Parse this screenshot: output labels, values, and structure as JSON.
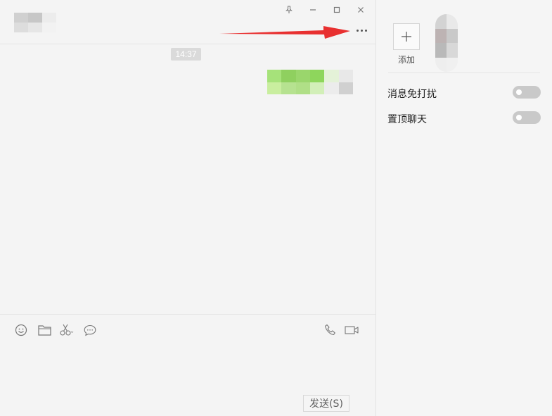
{
  "window": {
    "controls": [
      {
        "name": "pin",
        "icon": "pin-icon"
      },
      {
        "name": "minimize",
        "icon": "minimize-icon"
      },
      {
        "name": "maximize",
        "icon": "maximize-icon"
      },
      {
        "name": "close",
        "icon": "close-icon"
      }
    ]
  },
  "chat": {
    "more_icon": "ellipsis-icon",
    "messages": [
      {
        "type": "timestamp",
        "text": "14:37"
      },
      {
        "type": "outgoing",
        "content": "pixelated",
        "colors": [
          "#a8e07a",
          "#8fd05f",
          "#cfeeb5",
          "#e0e0e0"
        ]
      }
    ],
    "toolbar": {
      "left": [
        "emoji-icon",
        "folder-icon",
        "scissors-icon",
        "chat-bubble-icon"
      ],
      "right": [
        "phone-icon",
        "video-icon"
      ]
    },
    "send_label": "发送(S)"
  },
  "info": {
    "add_label": "添加",
    "settings": [
      {
        "label": "消息免打扰",
        "enabled": false
      },
      {
        "label": "置顶聊天",
        "enabled": false
      }
    ]
  },
  "colors": {
    "annotation_arrow": "#e83030",
    "toggle_off": "#c9c9c9",
    "bubble_green": "#95ec69"
  }
}
